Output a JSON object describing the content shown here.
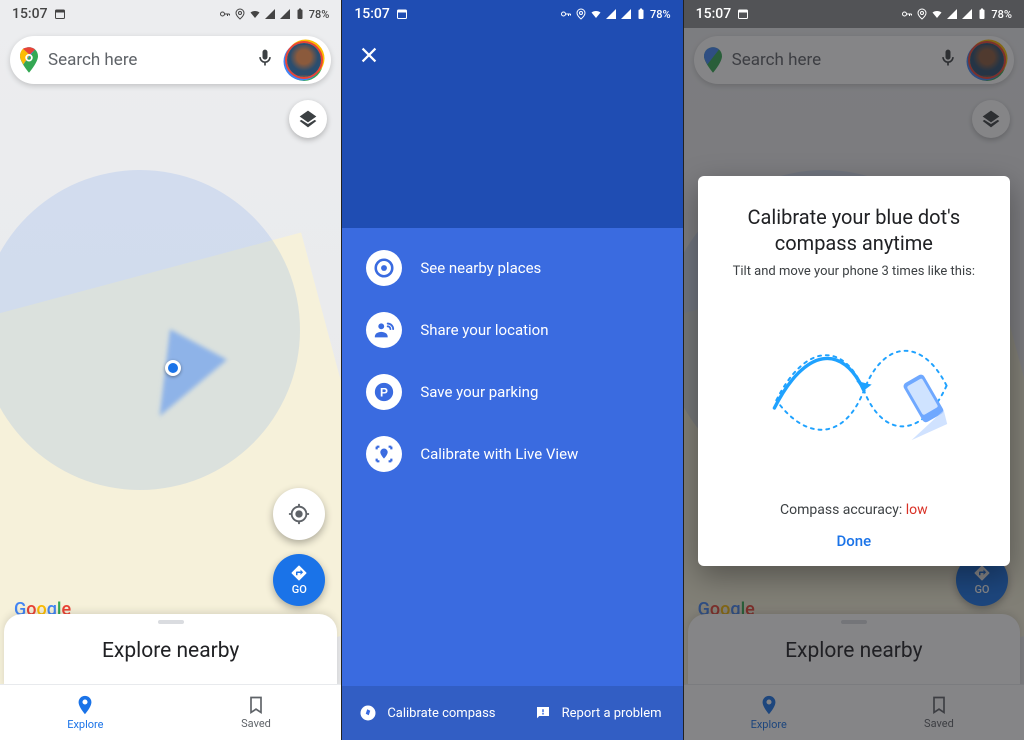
{
  "status": {
    "time": "15:07",
    "battery": "78%"
  },
  "screen1": {
    "search_placeholder": "Search here",
    "go_label": "GO",
    "explore_title": "Explore nearby",
    "nav_explore": "Explore",
    "nav_saved": "Saved",
    "google_logo": [
      "G",
      "o",
      "o",
      "g",
      "l",
      "e"
    ]
  },
  "screen2": {
    "actions": [
      {
        "icon": "nearby-icon",
        "label": "See nearby places"
      },
      {
        "icon": "share-location-icon",
        "label": "Share your location"
      },
      {
        "icon": "parking-icon",
        "label": "Save your parking"
      },
      {
        "icon": "live-view-icon",
        "label": "Calibrate with Live View"
      }
    ],
    "footer_calibrate": "Calibrate compass",
    "footer_report": "Report a problem"
  },
  "screen3": {
    "dialog_title": "Calibrate your blue dot's compass anytime",
    "dialog_sub": "Tilt and move your phone 3 times like this:",
    "accuracy_label": "Compass accuracy: ",
    "accuracy_value": "low",
    "done": "Done"
  }
}
